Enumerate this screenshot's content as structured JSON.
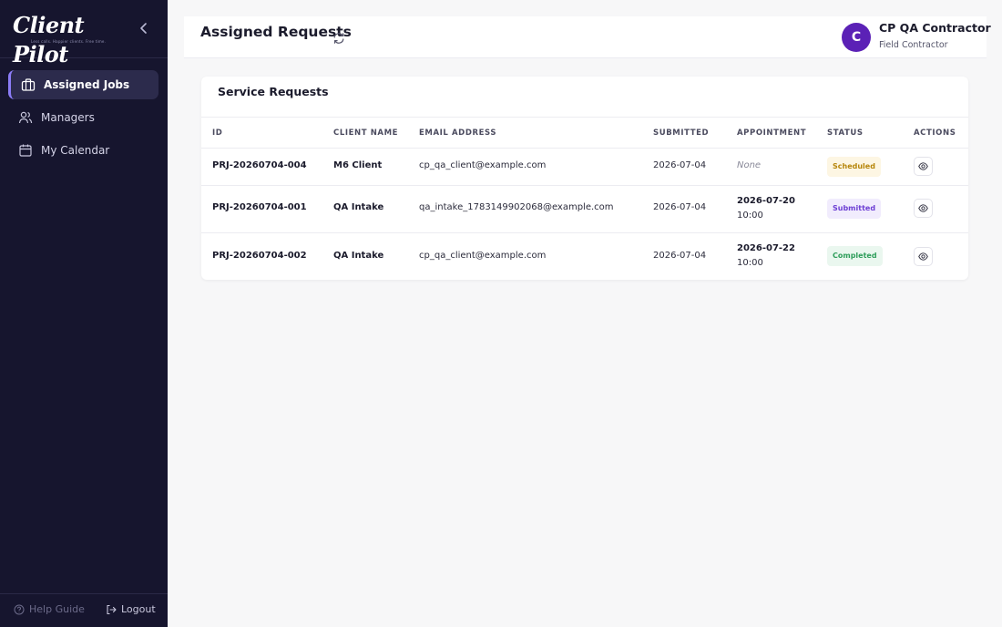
{
  "app": {
    "logo_text": "Client Pilot",
    "logo_tagline": "Less calls. Happier clients. Free time."
  },
  "sidebar": {
    "items": [
      {
        "label": "Assigned Jobs",
        "icon": "briefcase-icon",
        "active": true
      },
      {
        "label": "Managers",
        "icon": "users-icon",
        "active": false
      },
      {
        "label": "My Calendar",
        "icon": "calendar-icon",
        "active": false
      }
    ],
    "help_label": "Help Guide",
    "logout_label": "Logout"
  },
  "header": {
    "title": "Assigned Requests",
    "user": {
      "initial": "C",
      "name": "CP QA Contractor",
      "role": "Field Contractor"
    }
  },
  "table": {
    "title": "Service Requests",
    "columns": [
      "ID",
      "CLIENT NAME",
      "EMAIL ADDRESS",
      "SUBMITTED",
      "APPOINTMENT",
      "STATUS",
      "ACTIONS"
    ],
    "rows": [
      {
        "id": "PRJ-20260704-004",
        "client": "M6 Client",
        "email": "cp_qa_client@example.com",
        "submitted": "2026-07-04",
        "appointment_date": "None",
        "appointment_time": "",
        "status": "Scheduled"
      },
      {
        "id": "PRJ-20260704-001",
        "client": "QA Intake",
        "email": "qa_intake_1783149902068@example.com",
        "submitted": "2026-07-04",
        "appointment_date": "2026-07-20",
        "appointment_time": "10:00",
        "status": "Submitted"
      },
      {
        "id": "PRJ-20260704-002",
        "client": "QA Intake",
        "email": "cp_qa_client@example.com",
        "submitted": "2026-07-04",
        "appointment_date": "2026-07-22",
        "appointment_time": "10:00",
        "status": "Completed"
      }
    ]
  },
  "colors": {
    "sidebar_bg": "#16152e",
    "accent": "#8b7cf6",
    "avatar": "#5b21b6",
    "status_scheduled_bg": "#fdf6e3",
    "status_scheduled_fg": "#b7860b",
    "status_submitted_bg": "#f1ecfd",
    "status_submitted_fg": "#6d3fd4",
    "status_completed_bg": "#eaf7ef",
    "status_completed_fg": "#2f9e5b"
  }
}
